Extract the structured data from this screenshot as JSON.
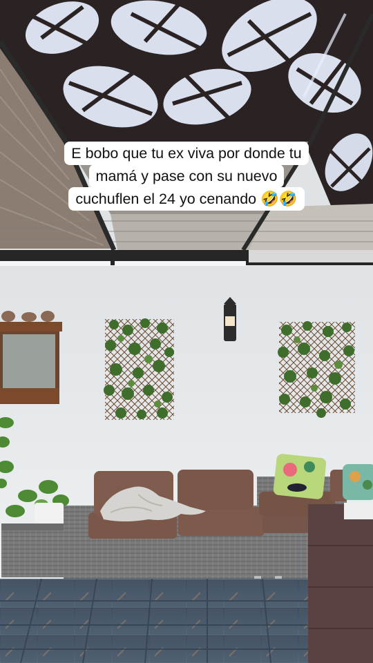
{
  "caption": {
    "line1": "E bobo que tu ex viva por donde tu",
    "line2": "mamá y pase con su nuevo",
    "line3": "cuchuflen el 24 yo cenando 🤣🤣"
  },
  "colors": {
    "ceiling": "#2b2323",
    "wall": "#e9ecee",
    "cushion": "#7a5748",
    "wicker": "#7c7c7c",
    "floor": "#4f6070",
    "ivy": "#3f6e2c"
  }
}
